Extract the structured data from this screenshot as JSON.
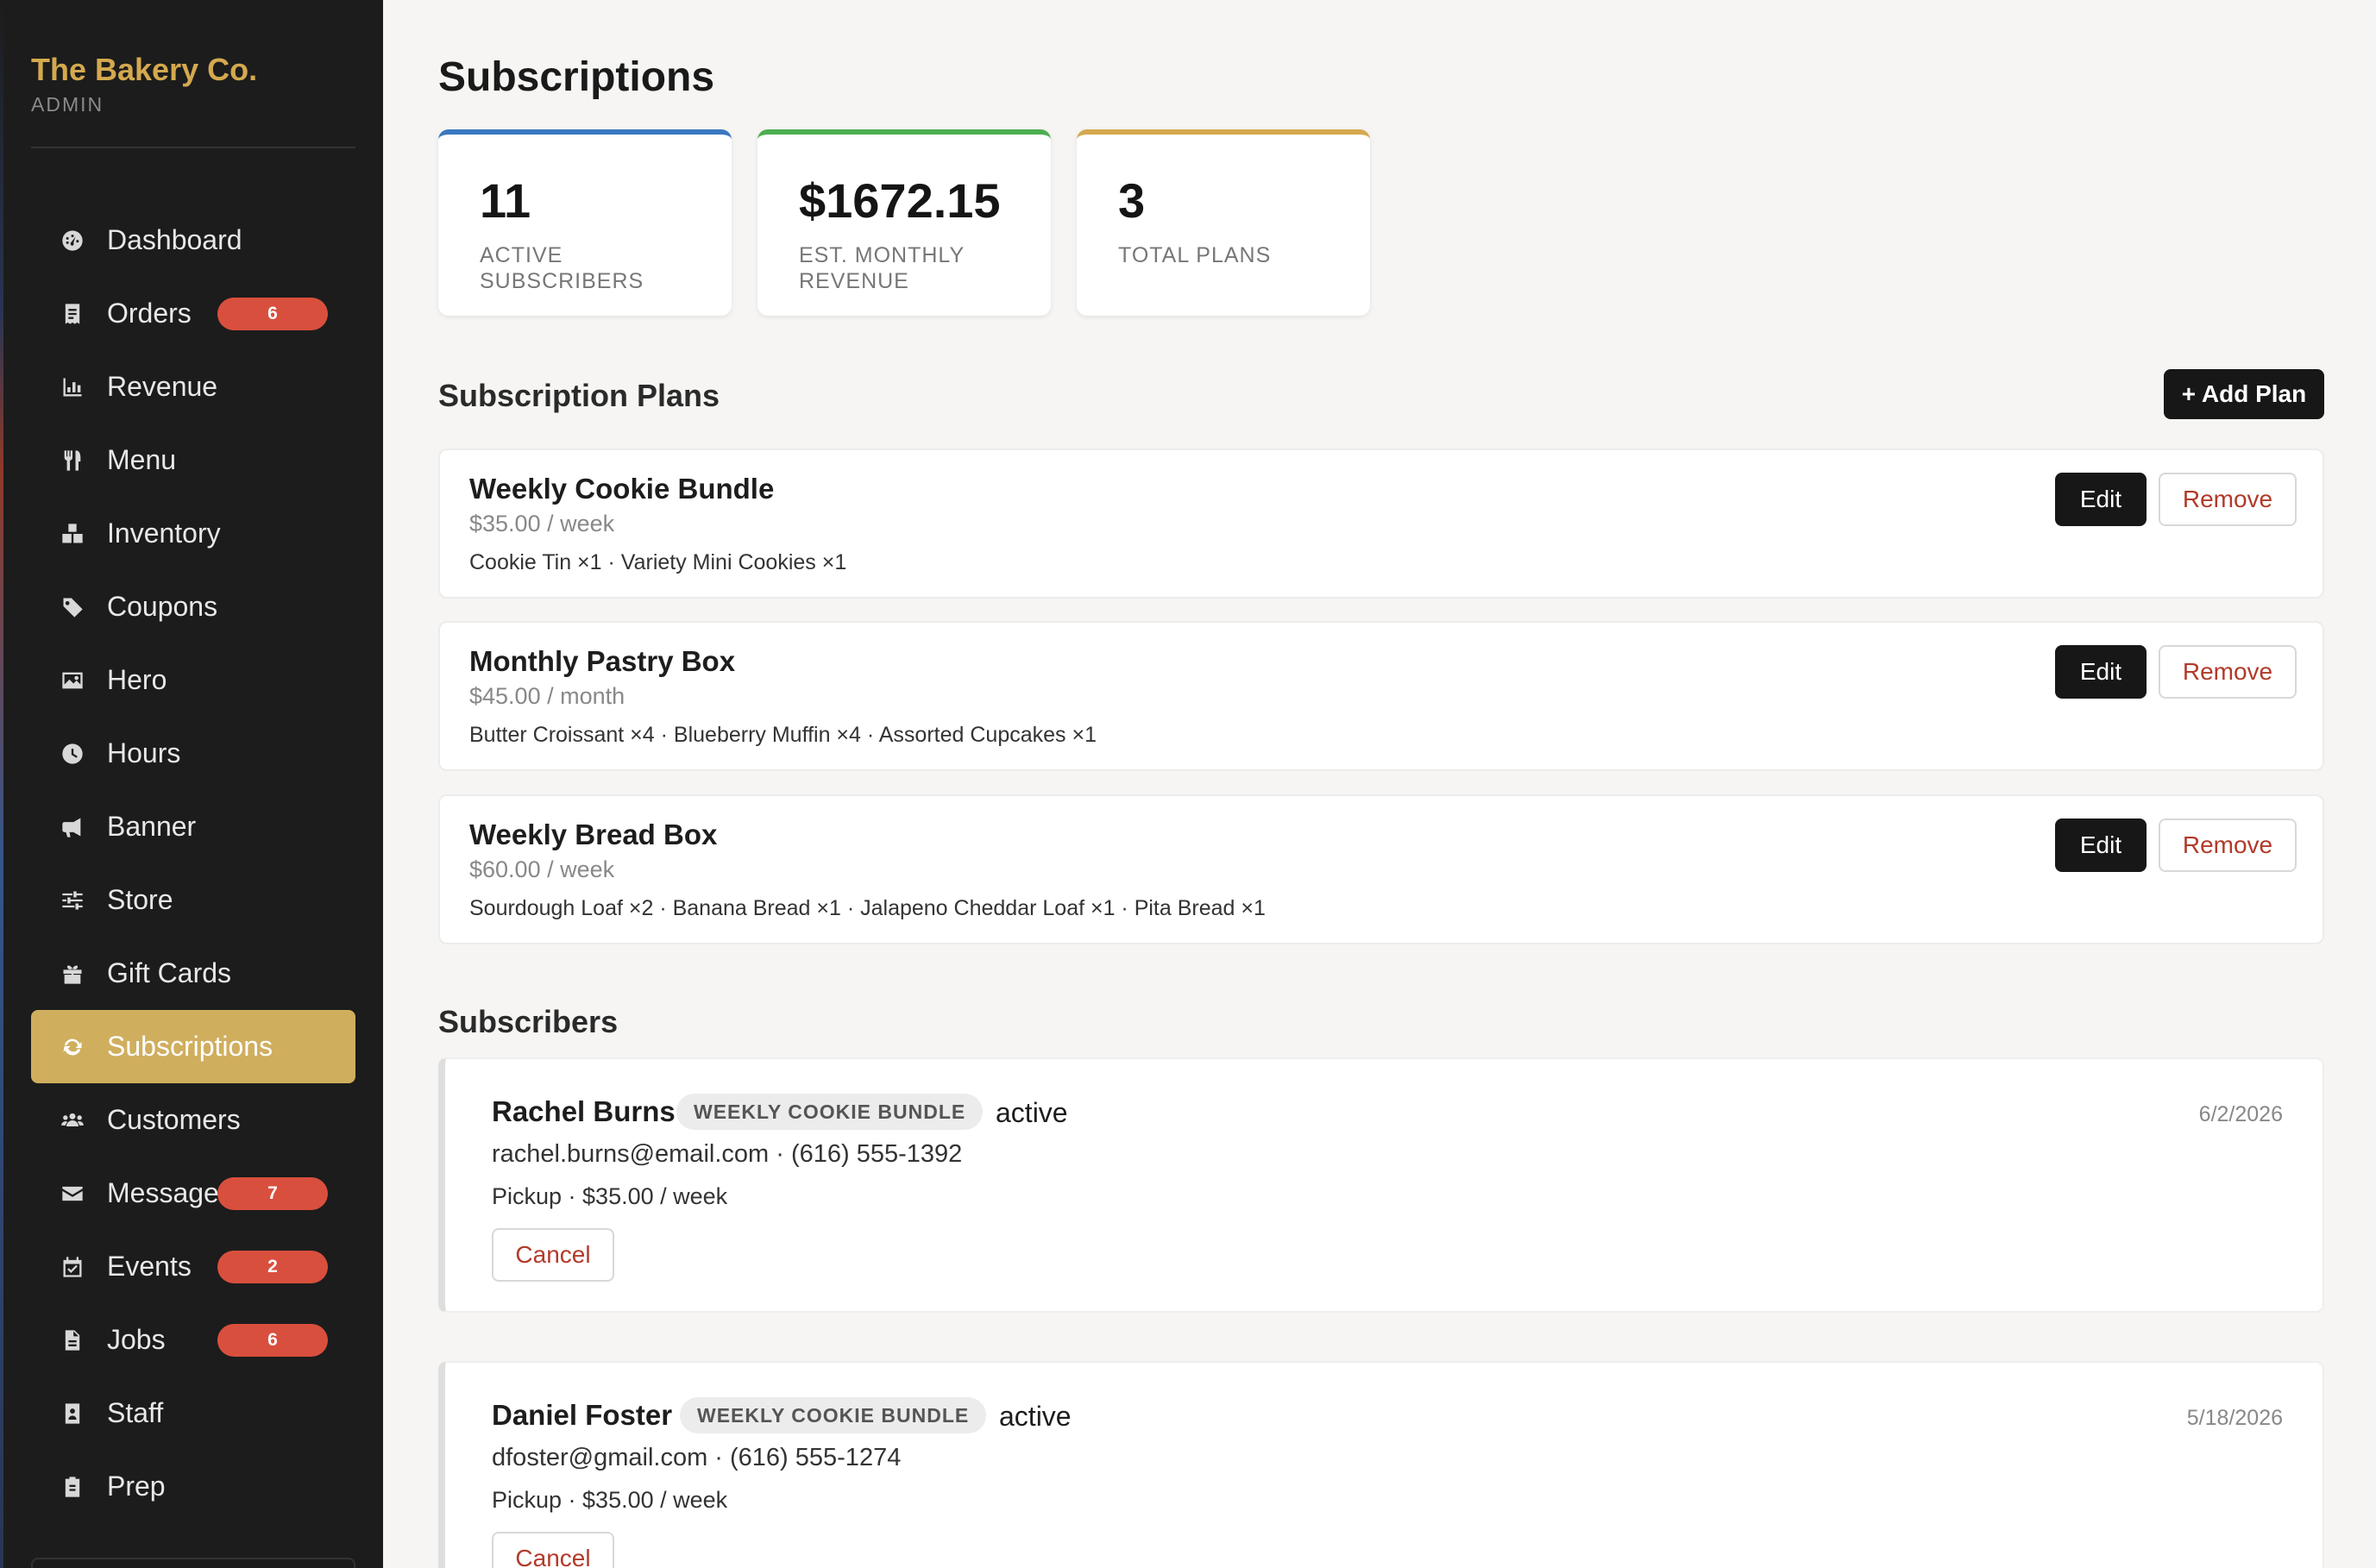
{
  "brand": {
    "name": "The Bakery Co.",
    "subtitle": "ADMIN"
  },
  "sidebar": {
    "items": [
      {
        "label": "Dashboard",
        "icon": "dashboard-icon",
        "badge": null,
        "active": false
      },
      {
        "label": "Orders",
        "icon": "receipt-icon",
        "badge": "6",
        "active": false
      },
      {
        "label": "Revenue",
        "icon": "chart-bar-icon",
        "badge": null,
        "active": false
      },
      {
        "label": "Menu",
        "icon": "utensils-icon",
        "badge": null,
        "active": false
      },
      {
        "label": "Inventory",
        "icon": "boxes-icon",
        "badge": null,
        "active": false
      },
      {
        "label": "Coupons",
        "icon": "tag-icon",
        "badge": null,
        "active": false
      },
      {
        "label": "Hero",
        "icon": "image-icon",
        "badge": null,
        "active": false
      },
      {
        "label": "Hours",
        "icon": "clock-icon",
        "badge": null,
        "active": false
      },
      {
        "label": "Banner",
        "icon": "megaphone-icon",
        "badge": null,
        "active": false
      },
      {
        "label": "Store",
        "icon": "sliders-icon",
        "badge": null,
        "active": false
      },
      {
        "label": "Gift Cards",
        "icon": "gift-icon",
        "badge": null,
        "active": false
      },
      {
        "label": "Subscriptions",
        "icon": "refresh-icon",
        "badge": null,
        "active": true
      },
      {
        "label": "Customers",
        "icon": "users-icon",
        "badge": null,
        "active": false
      },
      {
        "label": "Messages",
        "icon": "envelope-icon",
        "badge": "7",
        "active": false
      },
      {
        "label": "Events",
        "icon": "calendar-check-icon",
        "badge": "2",
        "active": false
      },
      {
        "label": "Jobs",
        "icon": "file-icon",
        "badge": "6",
        "active": false
      },
      {
        "label": "Staff",
        "icon": "id-badge-icon",
        "badge": null,
        "active": false
      },
      {
        "label": "Prep",
        "icon": "clipboard-icon",
        "badge": null,
        "active": false
      }
    ]
  },
  "page": {
    "title": "Subscriptions"
  },
  "stats": [
    {
      "value": "11",
      "label": "ACTIVE SUBSCRIBERS",
      "accent": "#3a78c0"
    },
    {
      "value": "$1672.15",
      "label": "EST. MONTHLY REVENUE",
      "accent": "#4caf50"
    },
    {
      "value": "3",
      "label": "TOTAL PLANS",
      "accent": "#d4a94e"
    }
  ],
  "plans_section": {
    "title": "Subscription Plans",
    "add_label": "+ Add Plan",
    "edit_label": "Edit",
    "remove_label": "Remove",
    "plans": [
      {
        "name": "Weekly Cookie Bundle",
        "price": "$35.00 / week",
        "items": "Cookie Tin ×1 · Variety Mini Cookies ×1"
      },
      {
        "name": "Monthly Pastry Box",
        "price": "$45.00 / month",
        "items": "Butter Croissant ×4 · Blueberry Muffin ×4 · Assorted Cupcakes ×1"
      },
      {
        "name": "Weekly Bread Box",
        "price": "$60.00 / week",
        "items": "Sourdough Loaf ×2 · Banana Bread ×1 · Jalapeno Cheddar Loaf ×1 · Pita Bread ×1"
      }
    ]
  },
  "subscribers_section": {
    "title": "Subscribers",
    "cancel_label": "Cancel",
    "subscribers": [
      {
        "name": "Rachel Burns",
        "plan_tag": "WEEKLY COOKIE BUNDLE",
        "status": "active",
        "date": "6/2/2026",
        "contact": "rachel.burns@email.com · (616) 555-1392",
        "plan_detail": "Pickup · $35.00 / week"
      },
      {
        "name": "Daniel Foster",
        "plan_tag": "WEEKLY COOKIE BUNDLE",
        "status": "active",
        "date": "5/18/2026",
        "contact": "dfoster@gmail.com · (616) 555-1274",
        "plan_detail": "Pickup · $35.00 / week"
      }
    ]
  },
  "colors": {
    "sidebar_bg": "#1c1c1c",
    "brand": "#d4a94e",
    "active_nav": "#cfae5e",
    "badge": "#d94f3d",
    "danger_text": "#b23a2a"
  }
}
